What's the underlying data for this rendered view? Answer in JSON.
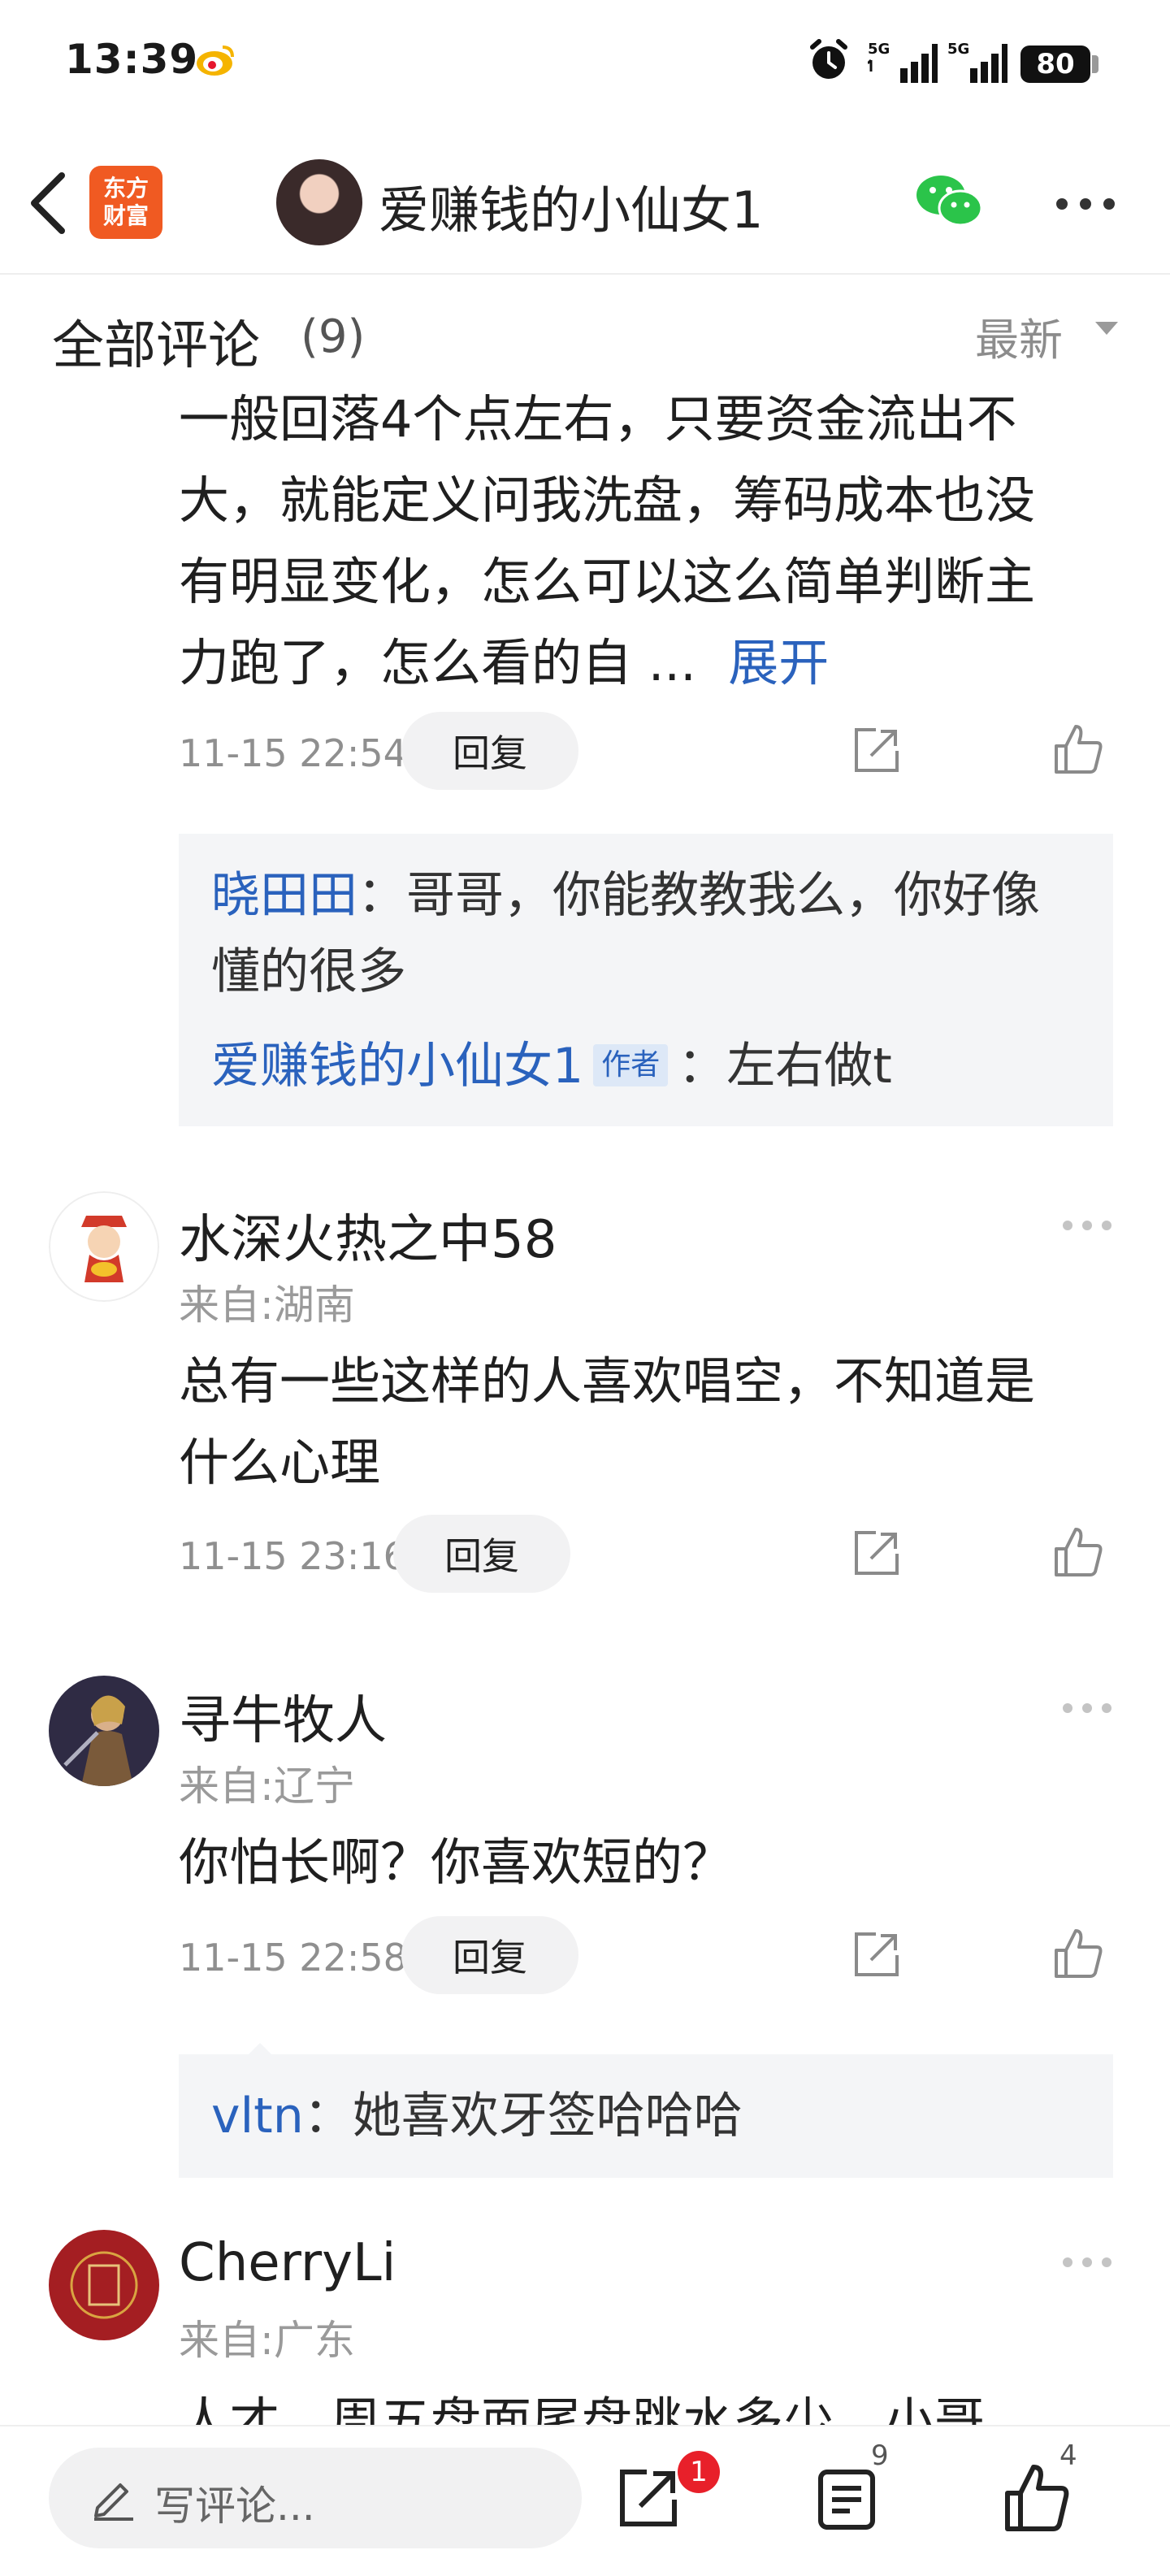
{
  "status_bar": {
    "time": "13:39",
    "battery": "80",
    "signal_1_label": "5G",
    "signal_2_label": "5G"
  },
  "header": {
    "logo_line1": "东方",
    "logo_line2": "财富",
    "title": "爱赚钱的小仙女1"
  },
  "section": {
    "title": "全部评论",
    "count": "(9)",
    "sort": "最新"
  },
  "comments": [
    {
      "text_lines": [
        "一般回落4个点左右，只要资金流出不",
        "大，就能定义问我洗盘，筹码成本也没",
        "有明显变化，怎么可以这么简单判断主",
        "力跑了，怎么看的自 ..."
      ],
      "expand": "展开",
      "time": "11-15 22:54",
      "reply_label": "回复",
      "replies": [
        {
          "name": "晓田田",
          "sep": "：",
          "text_line1": "哥哥，你能教教我么，你好像",
          "text_line2": "懂的很多"
        },
        {
          "name": "爱赚钱的小仙女1",
          "tag": "作者",
          "sep": "：",
          "text": "左右做t"
        }
      ]
    },
    {
      "name": "水深火热之中58",
      "location": "来自:湖南",
      "text_lines": [
        "总有一些这样的人喜欢唱空，不知道是",
        "什么心理"
      ],
      "time": "11-15 23:16",
      "reply_label": "回复"
    },
    {
      "name": "寻牛牧人",
      "location": "来自:辽宁",
      "text_lines": [
        "你怕长啊？你喜欢短的？"
      ],
      "time": "11-15 22:58",
      "reply_label": "回复",
      "replies": [
        {
          "name": "vltn",
          "sep": "：",
          "text": "她喜欢牙签哈哈哈"
        }
      ]
    },
    {
      "name": "CherryLi",
      "location": "来自:广东",
      "text_lines": [
        "人才，周五盘面尾盘跳水多少，小哥"
      ]
    }
  ],
  "bottom_bar": {
    "compose_placeholder": "写评论...",
    "share_badge": "1",
    "comment_count": "9",
    "like_count": "4"
  },
  "colors": {
    "link_blue": "#2a62bd",
    "brand_orange": "#f05a22",
    "badge_red": "#e8202a",
    "wechat_green": "#2bc44a"
  }
}
